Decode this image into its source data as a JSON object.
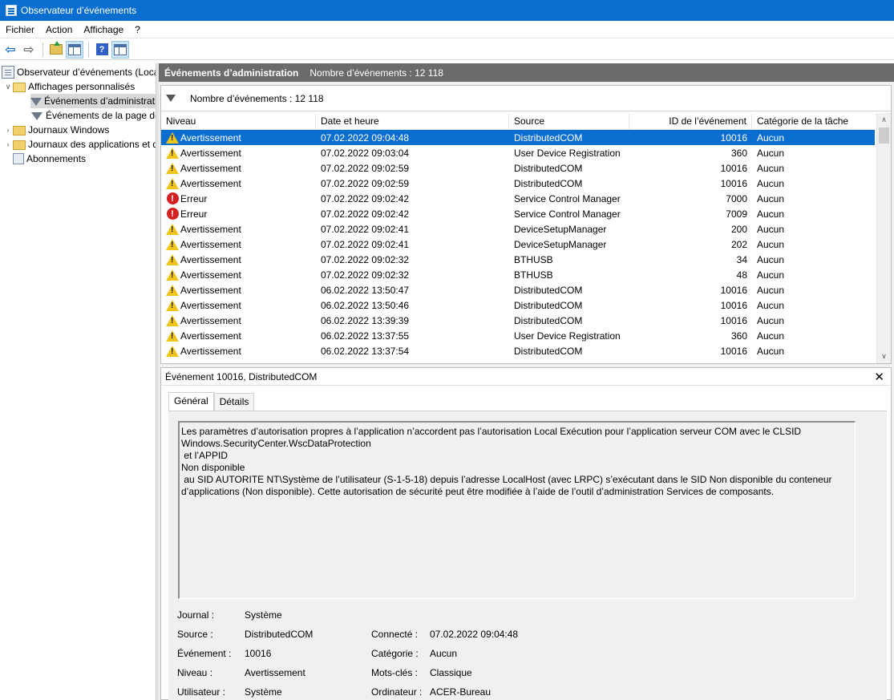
{
  "window": {
    "title": "Observateur d’événements"
  },
  "menu": [
    "Fichier",
    "Action",
    "Affichage",
    "?"
  ],
  "toolbar": {
    "icons": [
      "arrow-left-icon",
      "arrow-right-icon",
      "folder-up-icon",
      "show-hide-tree-icon",
      "help-icon",
      "show-hide-action-pane-icon"
    ]
  },
  "tree": {
    "root": "Observateur d’événements (Local)",
    "custom_views": "Affichages personnalisés",
    "admin_events": "Événements d’administration",
    "summary_page_events": "Événements de la page de résumé",
    "windows_logs": "Journaux Windows",
    "app_logs": "Journaux des applications et de services",
    "subscriptions": "Abonnements"
  },
  "header": {
    "title": "Événements d’administration",
    "count": "Nombre d’événements : 12 118"
  },
  "filter": {
    "count": "Nombre d’événements : 12 118"
  },
  "columns": {
    "level": "Niveau",
    "date": "Date et heure",
    "source": "Source",
    "id": "ID de l’événement",
    "category": "Catégorie de la tâche"
  },
  "events": [
    {
      "severity": "warning",
      "level": "Avertissement",
      "date": "07.02.2022 09:04:48",
      "source": "DistributedCOM",
      "id": "10016",
      "category": "Aucun",
      "selected": true
    },
    {
      "severity": "warning",
      "level": "Avertissement",
      "date": "07.02.2022 09:03:04",
      "source": "User Device Registration",
      "id": "360",
      "category": "Aucun"
    },
    {
      "severity": "warning",
      "level": "Avertissement",
      "date": "07.02.2022 09:02:59",
      "source": "DistributedCOM",
      "id": "10016",
      "category": "Aucun"
    },
    {
      "severity": "warning",
      "level": "Avertissement",
      "date": "07.02.2022 09:02:59",
      "source": "DistributedCOM",
      "id": "10016",
      "category": "Aucun"
    },
    {
      "severity": "error",
      "level": "Erreur",
      "date": "07.02.2022 09:02:42",
      "source": "Service Control Manager",
      "id": "7000",
      "category": "Aucun"
    },
    {
      "severity": "error",
      "level": "Erreur",
      "date": "07.02.2022 09:02:42",
      "source": "Service Control Manager",
      "id": "7009",
      "category": "Aucun"
    },
    {
      "severity": "warning",
      "level": "Avertissement",
      "date": "07.02.2022 09:02:41",
      "source": "DeviceSetupManager",
      "id": "200",
      "category": "Aucun"
    },
    {
      "severity": "warning",
      "level": "Avertissement",
      "date": "07.02.2022 09:02:41",
      "source": "DeviceSetupManager",
      "id": "202",
      "category": "Aucun"
    },
    {
      "severity": "warning",
      "level": "Avertissement",
      "date": "07.02.2022 09:02:32",
      "source": "BTHUSB",
      "id": "34",
      "category": "Aucun"
    },
    {
      "severity": "warning",
      "level": "Avertissement",
      "date": "07.02.2022 09:02:32",
      "source": "BTHUSB",
      "id": "48",
      "category": "Aucun"
    },
    {
      "severity": "warning",
      "level": "Avertissement",
      "date": "06.02.2022 13:50:47",
      "source": "DistributedCOM",
      "id": "10016",
      "category": "Aucun"
    },
    {
      "severity": "warning",
      "level": "Avertissement",
      "date": "06.02.2022 13:50:46",
      "source": "DistributedCOM",
      "id": "10016",
      "category": "Aucun"
    },
    {
      "severity": "warning",
      "level": "Avertissement",
      "date": "06.02.2022 13:39:39",
      "source": "DistributedCOM",
      "id": "10016",
      "category": "Aucun"
    },
    {
      "severity": "warning",
      "level": "Avertissement",
      "date": "06.02.2022 13:37:55",
      "source": "User Device Registration",
      "id": "360",
      "category": "Aucun"
    },
    {
      "severity": "warning",
      "level": "Avertissement",
      "date": "06.02.2022 13:37:54",
      "source": "DistributedCOM",
      "id": "10016",
      "category": "Aucun"
    }
  ],
  "detail": {
    "title": "Événement 10016, DistributedCOM",
    "tabs": {
      "general": "Général",
      "details": "Détails"
    },
    "message": "Les paramètres d’autorisation propres à l’application n’accordent pas l’autorisation Local Exécution pour l’application serveur COM avec le CLSID\nWindows.SecurityCenter.WscDataProtection\n et l’APPID\nNon disponible\n au SID AUTORITE NT\\Système de l’utilisateur (S-1-5-18) depuis l’adresse LocalHost (avec LRPC) s’exécutant dans le SID Non disponible du conteneur\nd’applications (Non disponible). Cette autorisation de sécurité peut être modifiée à l’aide de l’outil d’administration Services de composants.",
    "props": {
      "journal_label": "Journal :",
      "journal_value": "Système",
      "source_label": "Source :",
      "source_value": "DistributedCOM",
      "connected_label": "Connecté :",
      "connected_value": "07.02.2022 09:04:48",
      "event_label": "Événement :",
      "event_value": "10016",
      "category_label": "Catégorie :",
      "category_value": "Aucun",
      "level_label": "Niveau :",
      "level_value": "Avertissement",
      "keywords_label": "Mots-clés :",
      "keywords_value": "Classique",
      "user_label": "Utilisateur :",
      "user_value": "Système",
      "computer_label": "Ordinateur :",
      "computer_value": "ACER-Bureau"
    }
  }
}
